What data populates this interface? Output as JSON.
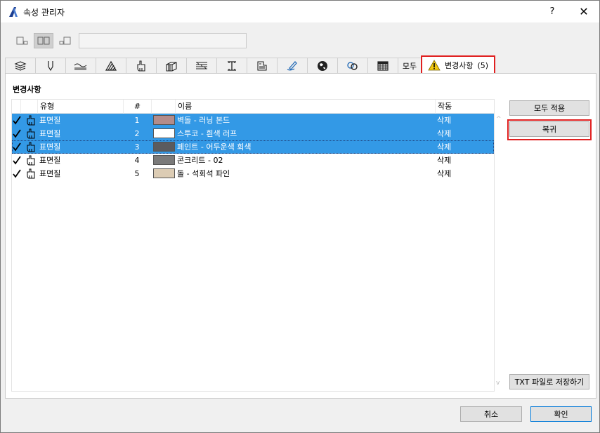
{
  "window": {
    "title": "속성 관리자",
    "help": "?",
    "close": "✕"
  },
  "tabs": {
    "icons": [
      "layers-icon",
      "pen-icon",
      "line-type-icon",
      "fill-icon",
      "surface-icon",
      "composite-icon",
      "profile-icon",
      "zone-icon",
      "markup-icon",
      "material-icon",
      "globe-icon",
      "link-icon",
      "grid-icon"
    ],
    "all_label": "모두",
    "changes_label": "변경사항",
    "changes_count": "(5)"
  },
  "section": {
    "title": "변경사항"
  },
  "list": {
    "columns": {
      "type": "유형",
      "num": "#",
      "name": "이름",
      "action": "작동"
    },
    "rows": [
      {
        "type": "표면질",
        "num": "1",
        "name": "벽돌 - 러닝 본드",
        "action": "삭제",
        "color": "#b48c8a",
        "selected": true
      },
      {
        "type": "표면질",
        "num": "2",
        "name": "스투코 - 흰색 러프",
        "action": "삭제",
        "color": "#ffffff",
        "selected": true
      },
      {
        "type": "표면질",
        "num": "3",
        "name": "페인트 - 어두운색 회색",
        "action": "삭제",
        "color": "#5b5b5e",
        "selected": true
      },
      {
        "type": "표면질",
        "num": "4",
        "name": "콘크리트 - 02",
        "action": "삭제",
        "color": "#7a7a7a",
        "selected": false
      },
      {
        "type": "표면질",
        "num": "5",
        "name": "돌 - 석회석 파인",
        "action": "삭제",
        "color": "#dcccb4",
        "selected": false
      }
    ]
  },
  "buttons": {
    "apply_all": "모두 적용",
    "restore": "복귀",
    "save_txt": "TXT 파일로 저장하기",
    "cancel": "취소",
    "ok": "확인"
  },
  "colors": {
    "selection": "#3399e6",
    "highlight": "#e02020",
    "warning": "#f2c811"
  }
}
